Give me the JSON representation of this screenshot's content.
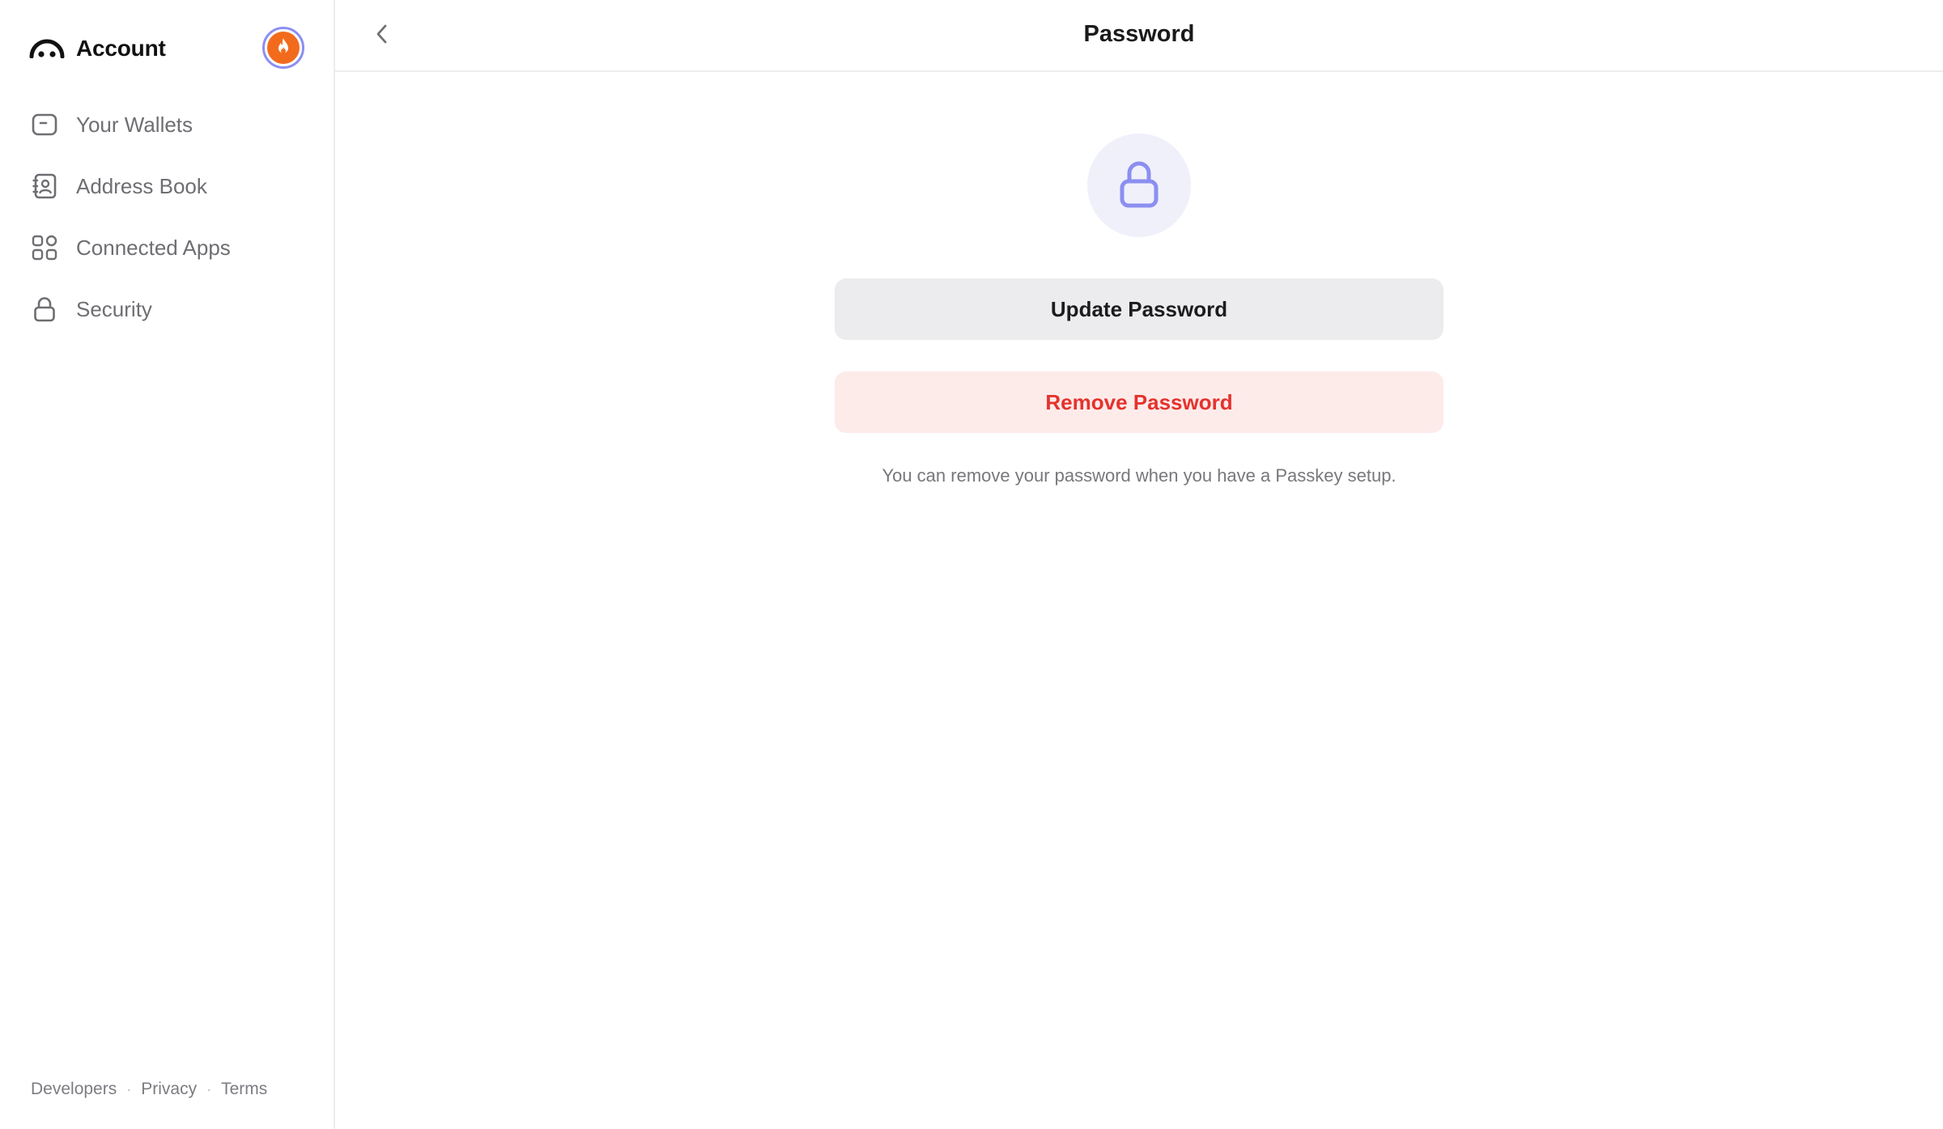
{
  "sidebar": {
    "brand_title": "Account",
    "brand_logo_icon": "rainbow-arc-logo",
    "avatar_icon": "flame-icon",
    "items": [
      {
        "label": "Your Wallets",
        "icon": "wallet-icon"
      },
      {
        "label": "Address Book",
        "icon": "contact-book-icon"
      },
      {
        "label": "Connected Apps",
        "icon": "apps-grid-icon"
      },
      {
        "label": "Security",
        "icon": "lock-icon"
      }
    ],
    "footer": {
      "developers": "Developers",
      "separator": "·",
      "privacy": "Privacy",
      "terms": "Terms"
    }
  },
  "header": {
    "title": "Password",
    "back_icon": "chevron-left-icon"
  },
  "main": {
    "hero_icon": "lock-icon",
    "update_button": "Update Password",
    "remove_button": "Remove Password",
    "hint": "You can remove your password when you have a Passkey setup."
  },
  "colors": {
    "accent": "#8b8ff0",
    "avatar_bg": "#f26b1d",
    "danger_text": "#e5322d",
    "danger_bg": "#fdebea",
    "neutral_button_bg": "#ececee",
    "hero_circle_bg": "#f0f0fb"
  }
}
